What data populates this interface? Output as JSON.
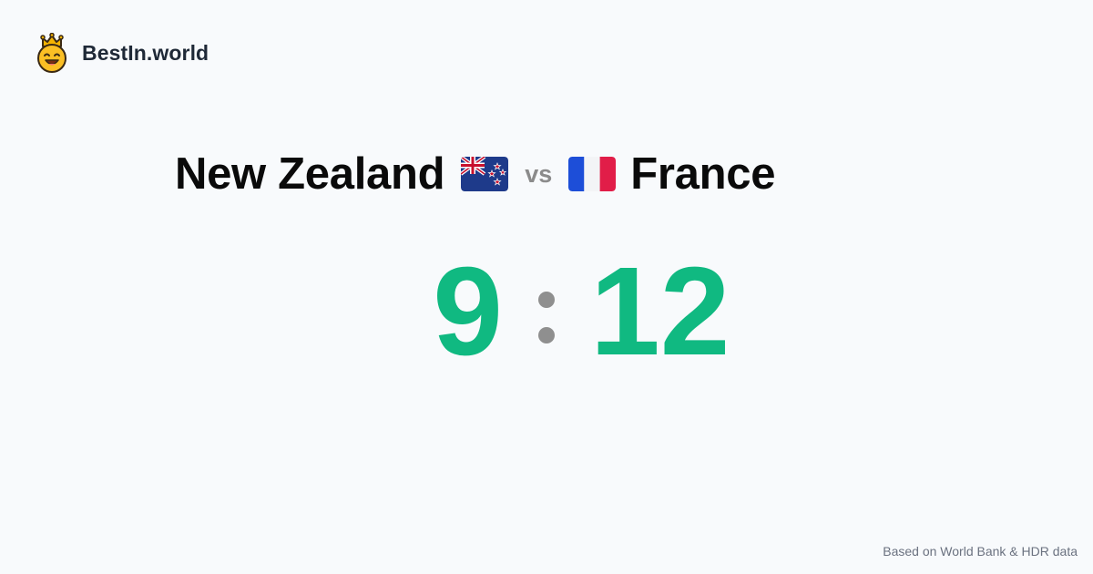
{
  "brand": {
    "name": "BestIn.world",
    "logo_icon": "crowned-smiley-icon",
    "logo_color": "#f5b301"
  },
  "matchup": {
    "left": {
      "name": "New Zealand",
      "flag_icon": "new-zealand-flag-icon"
    },
    "vs_label": "vs",
    "right": {
      "name": "France",
      "flag_icon": "france-flag-icon"
    }
  },
  "score": {
    "left": "9",
    "right": "12",
    "color": "#10b981",
    "separator_color": "#8f8f8f"
  },
  "footer": {
    "source": "Based on World Bank & HDR data"
  }
}
